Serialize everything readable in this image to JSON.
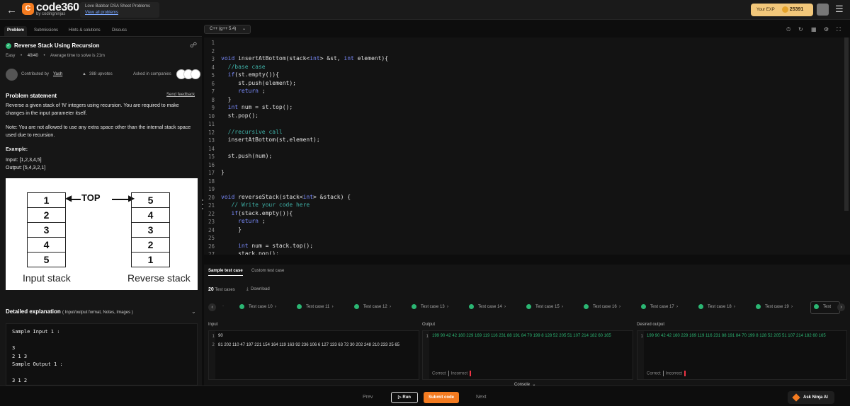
{
  "header": {
    "logo_text": "code360",
    "logo_sub": "by codingninjas",
    "sheet_title": "Love Babbar DSA Sheet Problems",
    "sheet_link": "View all problems",
    "exp_label": "Your EXP",
    "exp_value": "25391"
  },
  "left_tabs": [
    "Problem",
    "Submissions",
    "Hints & solutions",
    "Discuss"
  ],
  "problem": {
    "title": "Reverse Stack Using Recursion",
    "difficulty": "Easy",
    "points": "40/40",
    "avg_time": "Average time to solve is 21m",
    "contributed_by": "Contributed by",
    "author": "Yash",
    "upvotes": "388 upvotes",
    "asked_in": "Asked in companies",
    "statement_heading": "Problem statement",
    "feedback": "Send feedback",
    "para1": "Reverse a given stack of 'N' integers using recursion. You are required to make changes in the input parameter itself.",
    "para2": "Note: You are not allowed to use any extra space other than the internal stack space used due to recursion.",
    "example_heading": "Example:",
    "example_input": "Input: [1,2,3,4,5]",
    "example_output": "Output: [5,4,3,2,1]",
    "detailed": "Detailed explanation",
    "detailed_sub": "( Input/output format, Notes, Images )",
    "sample_text": "Sample Input 1 :\n\n3\n2 1 3\nSample Output 1 :\n\n3 1 2\n\nExplanation to Sample Input 1 :"
  },
  "diagram": {
    "input_stack": [
      "1",
      "2",
      "3",
      "4",
      "5"
    ],
    "reverse_stack": [
      "5",
      "4",
      "3",
      "2",
      "1"
    ],
    "top_label": "TOP",
    "input_caption": "Input stack",
    "reverse_caption": "Reverse stack"
  },
  "editor": {
    "language": "C++ (g++ 5.4)",
    "line_numbers": [
      "1",
      "2",
      "3",
      "4",
      "5",
      "6",
      "7",
      "8",
      "9",
      "10",
      "11",
      "12",
      "13",
      "14",
      "15",
      "16",
      "17",
      "18",
      "19",
      "20",
      "21",
      "22",
      "23",
      "24",
      "25",
      "26",
      "27"
    ]
  },
  "bottom": {
    "tabs": [
      "Sample test case",
      "Custom test case"
    ],
    "test_count": "20",
    "test_count_label": "Test cases",
    "download": "Download",
    "test_cases": [
      "Test case 10",
      "Test case 11",
      "Test case 12",
      "Test case 13",
      "Test case 14",
      "Test case 15",
      "Test case 16",
      "Test case 17",
      "Test case 18",
      "Test case 19",
      "Test"
    ],
    "input_label": "Input",
    "output_label": "Output",
    "desired_label": "Desired output",
    "input_line1": "90",
    "input_line2": "81 202 110 47 197 221 154 164 119 163 92 236 106 6 127 133 63 72 30 202 248 210 233 25 65",
    "output_line": "199 90 42 42 160 229 169 119 116 231 88 191 84 70 199 8 128 52 205 51 107 214 182 60 165",
    "desired_line": "199 90 42 42 160 229 169 119 116 231 88 191 84 70 199 8 128 52 205 51 107 214 182 60 165",
    "correct": "Correct",
    "incorrect": "Incorrect",
    "console": "Console"
  },
  "footer": {
    "prev": "Prev",
    "run": "Run",
    "submit": "Submit code",
    "next": "Next",
    "ask": "Ask Ninja AI"
  }
}
